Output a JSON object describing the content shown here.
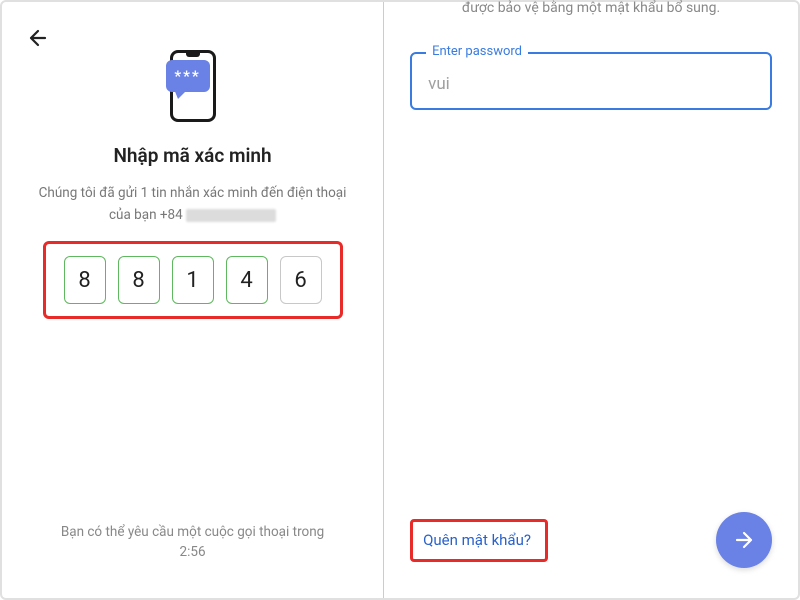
{
  "left": {
    "title": "Nhập mã xác minh",
    "subtitle": "Chúng tôi đã gửi 1 tin nhắn xác minh đến điện thoại",
    "phone_prefix": "của bạn +84",
    "code": [
      "8",
      "8",
      "1",
      "4",
      "6"
    ],
    "voice_hint_line1": "Bạn có thể yêu cầu một cuộc gọi thoại trong",
    "voice_hint_timer": "2:56",
    "sms_glyph": "***"
  },
  "right": {
    "top_partial": "được bảo vệ bằng một mật khẩu bổ sung.",
    "password_label": "Enter password",
    "password_value": "vui",
    "forgot": "Quên mật khẩu?"
  }
}
